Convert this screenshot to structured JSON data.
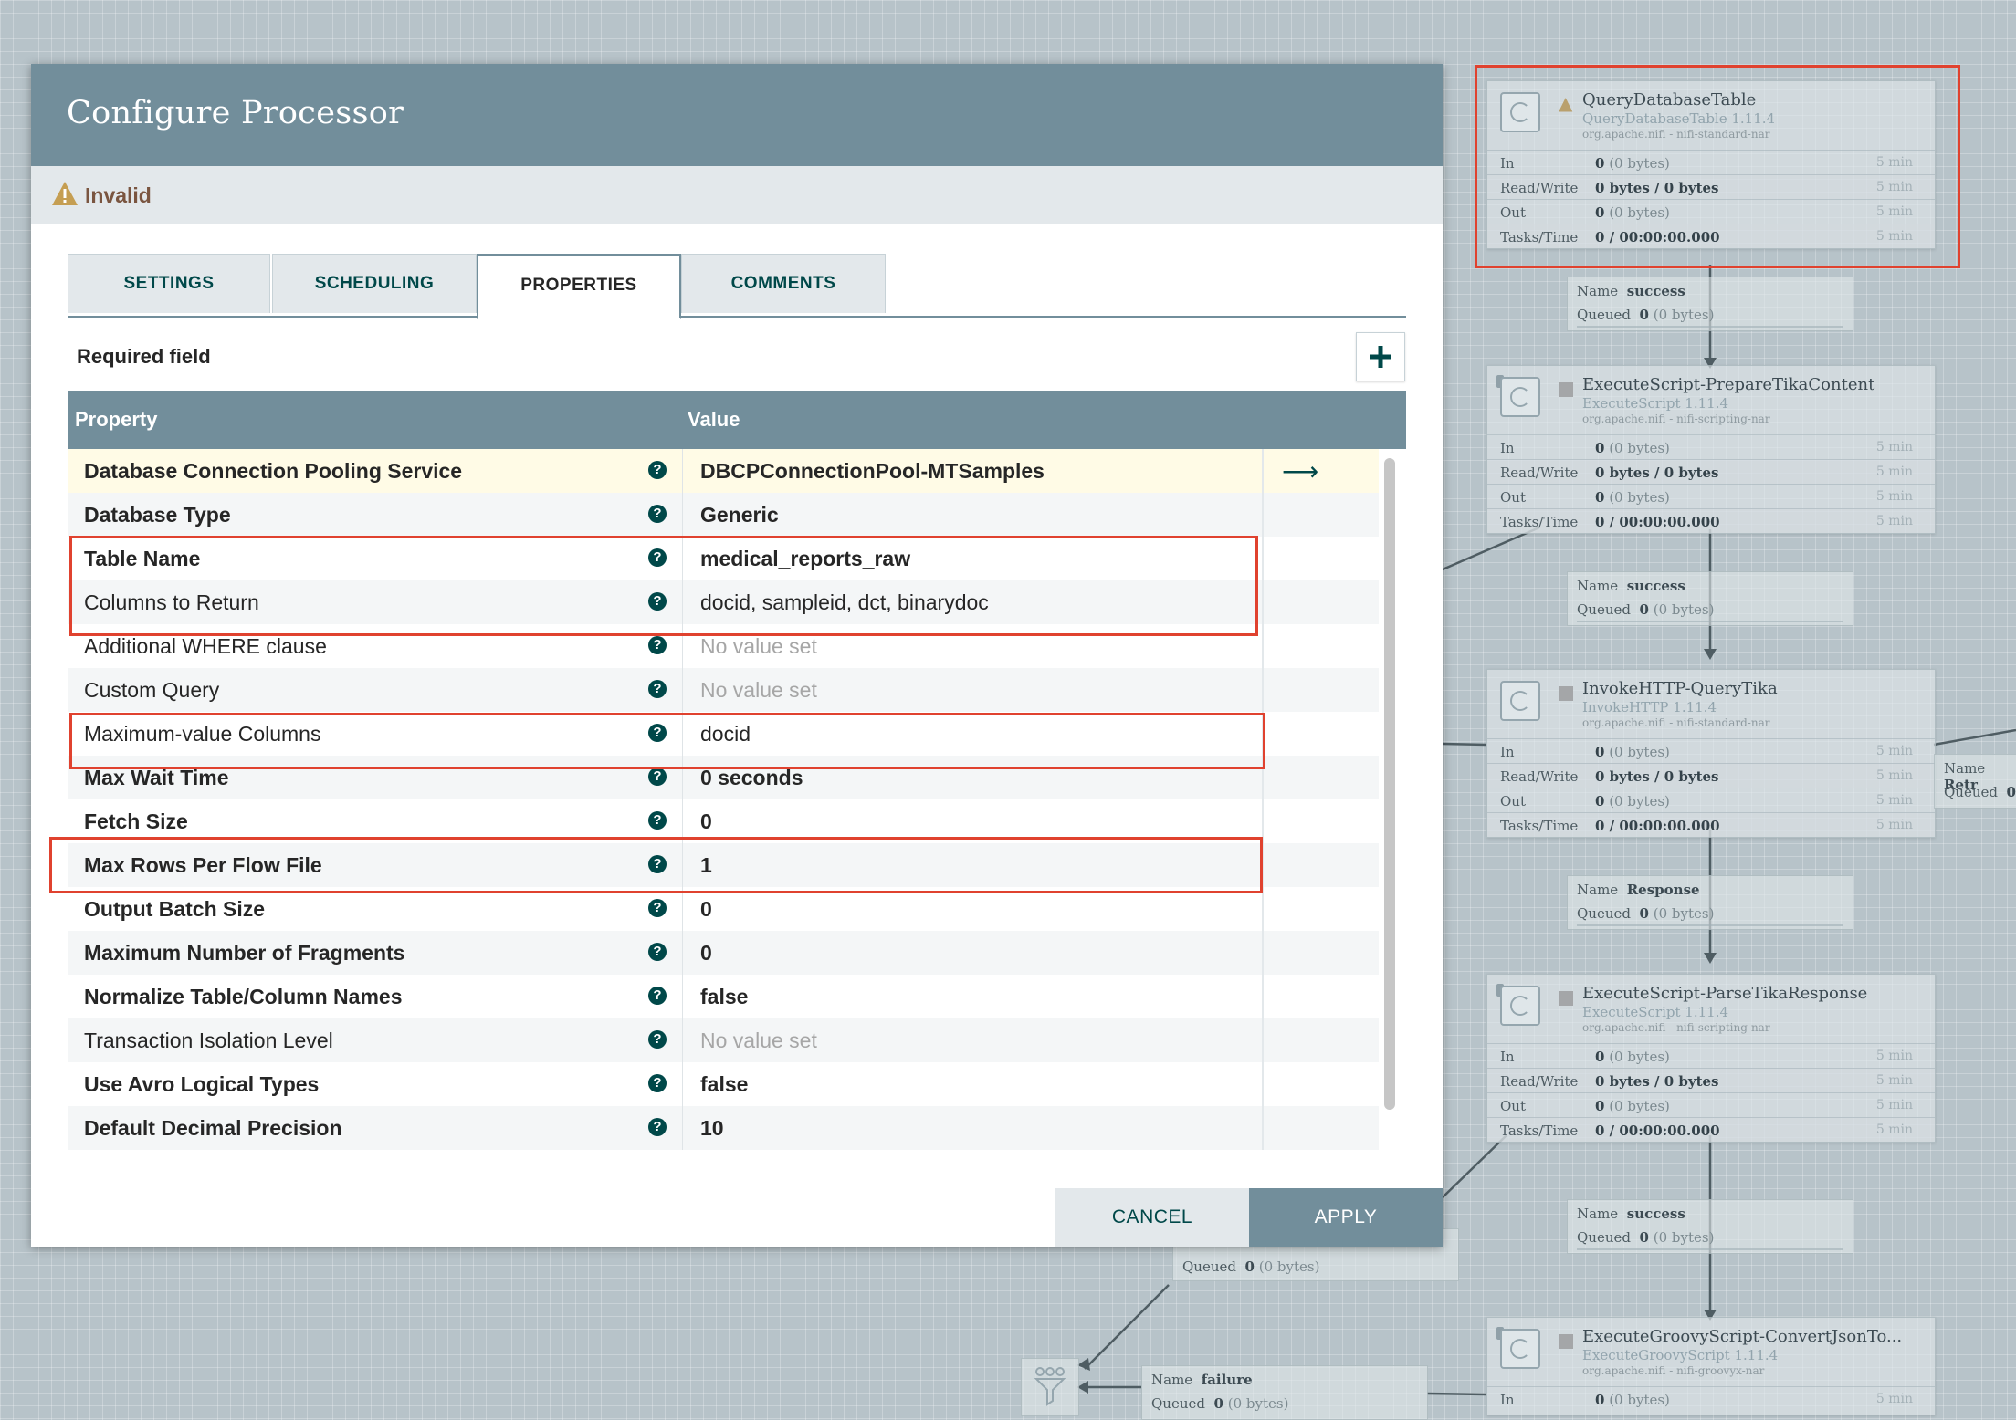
{
  "dialog": {
    "title": "Configure Processor",
    "status": "Invalid",
    "tabs": [
      "SETTINGS",
      "SCHEDULING",
      "PROPERTIES",
      "COMMENTS"
    ],
    "active_tab": "PROPERTIES",
    "required_field": "Required field",
    "add_property_icon": "plus-icon",
    "columns": {
      "property": "Property",
      "value": "Value"
    },
    "properties": [
      {
        "name": "Database Connection Pooling Service",
        "value": "DBCPConnectionPool-MTSamples",
        "required": true,
        "unset": false
      },
      {
        "name": "Database Type",
        "value": "Generic",
        "required": true,
        "unset": false
      },
      {
        "name": "Table Name",
        "value": "medical_reports_raw",
        "required": true,
        "unset": false
      },
      {
        "name": "Columns to Return",
        "value": "docid, sampleid, dct, binarydoc",
        "required": false,
        "unset": false
      },
      {
        "name": "Additional WHERE clause",
        "value": "No value set",
        "required": false,
        "unset": true
      },
      {
        "name": "Custom Query",
        "value": "No value set",
        "required": false,
        "unset": true
      },
      {
        "name": "Maximum-value Columns",
        "value": "docid",
        "required": false,
        "unset": false
      },
      {
        "name": "Max Wait Time",
        "value": "0 seconds",
        "required": true,
        "unset": false
      },
      {
        "name": "Fetch Size",
        "value": "0",
        "required": true,
        "unset": false
      },
      {
        "name": "Max Rows Per Flow File",
        "value": "1",
        "required": true,
        "unset": false
      },
      {
        "name": "Output Batch Size",
        "value": "0",
        "required": true,
        "unset": false
      },
      {
        "name": "Maximum Number of Fragments",
        "value": "0",
        "required": true,
        "unset": false
      },
      {
        "name": "Normalize Table/Column Names",
        "value": "false",
        "required": true,
        "unset": false
      },
      {
        "name": "Transaction Isolation Level",
        "value": "No value set",
        "required": false,
        "unset": true
      },
      {
        "name": "Use Avro Logical Types",
        "value": "false",
        "required": true,
        "unset": false
      },
      {
        "name": "Default Decimal Precision",
        "value": "10",
        "required": true,
        "unset": false
      }
    ],
    "buttons": {
      "cancel": "CANCEL",
      "apply": "APPLY"
    }
  },
  "canvas": {
    "processors": [
      {
        "name": "QueryDatabaseTable",
        "type": "QueryDatabaseTable 1.11.4",
        "bundle": "org.apache.nifi - nifi-standard-nar",
        "stats": [
          {
            "k": "In",
            "v": "0",
            "d": " (0 bytes)",
            "t": "5 min"
          },
          {
            "k": "Read/Write",
            "v": "0 bytes / 0 bytes",
            "d": "",
            "t": "5 min"
          },
          {
            "k": "Out",
            "v": "0",
            "d": " (0 bytes)",
            "t": "5 min"
          },
          {
            "k": "Tasks/Time",
            "v": "0 / 00:00:00.000",
            "d": "",
            "t": "5 min"
          }
        ]
      },
      {
        "name": "ExecuteScript-PrepareTikaContent",
        "type": "ExecuteScript 1.11.4",
        "bundle": "org.apache.nifi - nifi-scripting-nar",
        "stats": [
          {
            "k": "In",
            "v": "0",
            "d": " (0 bytes)",
            "t": "5 min"
          },
          {
            "k": "Read/Write",
            "v": "0 bytes / 0 bytes",
            "d": "",
            "t": "5 min"
          },
          {
            "k": "Out",
            "v": "0",
            "d": " (0 bytes)",
            "t": "5 min"
          },
          {
            "k": "Tasks/Time",
            "v": "0 / 00:00:00.000",
            "d": "",
            "t": "5 min"
          }
        ]
      },
      {
        "name": "InvokeHTTP-QueryTika",
        "type": "InvokeHTTP 1.11.4",
        "bundle": "org.apache.nifi - nifi-standard-nar",
        "stats": [
          {
            "k": "In",
            "v": "0",
            "d": " (0 bytes)",
            "t": "5 min"
          },
          {
            "k": "Read/Write",
            "v": "0 bytes / 0 bytes",
            "d": "",
            "t": "5 min"
          },
          {
            "k": "Out",
            "v": "0",
            "d": " (0 bytes)",
            "t": "5 min"
          },
          {
            "k": "Tasks/Time",
            "v": "0 / 00:00:00.000",
            "d": "",
            "t": "5 min"
          }
        ]
      },
      {
        "name": "ExecuteScript-ParseTikaResponse",
        "type": "ExecuteScript 1.11.4",
        "bundle": "org.apache.nifi - nifi-scripting-nar",
        "stats": [
          {
            "k": "In",
            "v": "0",
            "d": " (0 bytes)",
            "t": "5 min"
          },
          {
            "k": "Read/Write",
            "v": "0 bytes / 0 bytes",
            "d": "",
            "t": "5 min"
          },
          {
            "k": "Out",
            "v": "0",
            "d": " (0 bytes)",
            "t": "5 min"
          },
          {
            "k": "Tasks/Time",
            "v": "0 / 00:00:00.000",
            "d": "",
            "t": "5 min"
          }
        ]
      },
      {
        "name": "ExecuteGroovyScript-ConvertJsonTo...",
        "type": "ExecuteGroovyScript 1.11.4",
        "bundle": "org.apache.nifi - nifi-groovyx-nar",
        "stats": [
          {
            "k": "In",
            "v": "0",
            "d": " (0 bytes)",
            "t": "5 min"
          }
        ]
      }
    ],
    "connections": [
      {
        "name_label": "Name",
        "name": "success",
        "queued_label": "Queued",
        "queued": "0",
        "queued_bytes": " (0 bytes)"
      },
      {
        "name_label": "Name",
        "name": "success",
        "queued_label": "Queued",
        "queued": "0",
        "queued_bytes": " (0 bytes)"
      },
      {
        "name_label": "Name",
        "name": "Response",
        "queued_label": "Queued",
        "queued": "0",
        "queued_bytes": " (0 bytes)"
      },
      {
        "name_label": "Name",
        "name": "success",
        "queued_label": "Queued",
        "queued": "0",
        "queued_bytes": " (0 bytes)"
      },
      {
        "name_label": "Name",
        "name": "failure",
        "queued_label": "Queued",
        "queued": "0",
        "queued_bytes": " (0 bytes)"
      }
    ],
    "partial_connections": [
      {
        "name_label": "Name",
        "name": "Retr",
        "queued_label": "Queued",
        "queued": "0"
      },
      {
        "queued_label": "Queued",
        "queued": "0",
        "queued_bytes": " (0 bytes)"
      }
    ]
  },
  "colors": {
    "header": "#728e9b",
    "accent": "#004849",
    "highlight_box": "#e0422f",
    "invalid_text": "#7a5540",
    "warning": "#c59e52"
  }
}
